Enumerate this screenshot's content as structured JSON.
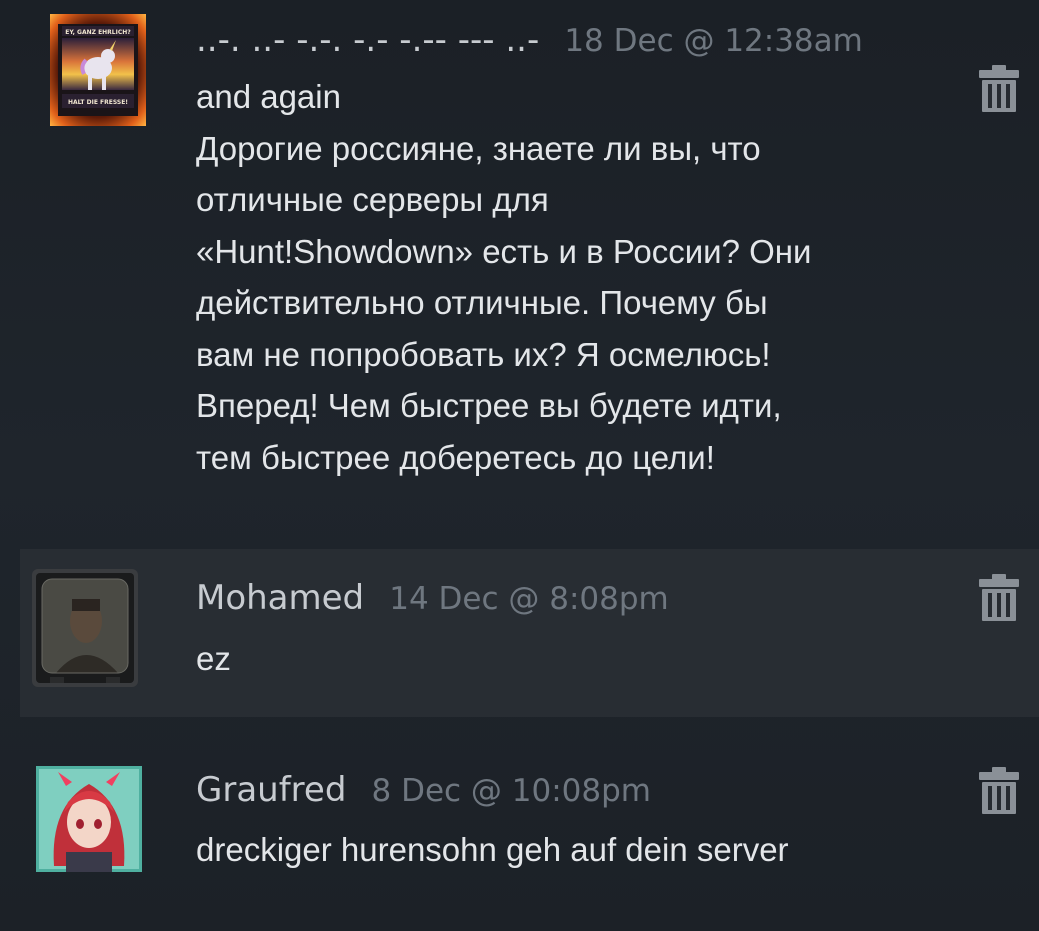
{
  "comments": [
    {
      "author": "..-. ..- -.-. -.- -.-- --- ..-",
      "timestamp": "18 Dec @ 12:38am",
      "text": "and again\nДорогие россияне, знаете ли вы, что\nотличные серверы для\n«Hunt!Showdown» есть и в России? Они\nдействительно отличные. Почему бы\nвам не попробовать их? Я осмелюсь!\nВперед! Чем быстрее вы будете идти,\nтем быстрее доберетесь до цели!",
      "avatar_icon": "unicorn-banner-avatar",
      "avatar_caption_top": "EY, GANZ EHRLICH?",
      "avatar_caption_bottom": "HALT DIE FRESSE!",
      "highlighted": false
    },
    {
      "author": "Mohamed",
      "timestamp": "14 Dec @ 8:08pm",
      "text": "ez",
      "avatar_icon": "tv-portrait-avatar",
      "highlighted": true
    },
    {
      "author": "Graufred",
      "timestamp": "8 Dec @ 10:08pm",
      "text": "dreckiger hurensohn geh auf dein server",
      "avatar_icon": "anime-girl-avatar",
      "highlighted": false
    }
  ],
  "delete_icon": "trash-icon",
  "colors": {
    "author": "#c7cbd0",
    "timestamp": "#6f7780",
    "text": "#e3e6e9",
    "highlight_bg": "#282d33"
  }
}
